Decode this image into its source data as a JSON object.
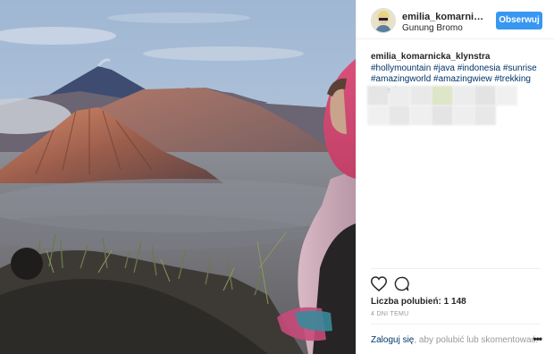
{
  "post": {
    "username": "emilia_komarnicka_klynstra",
    "location": "Gunung Bromo",
    "follow_label": "Obserwuj"
  },
  "caption": {
    "username": "emilia_komarnicka_klynstra",
    "hashtags": [
      "#hollymountain",
      "#java",
      "#indonesia",
      "#sunrise",
      "#amazingworld",
      "#amazingwiew",
      "#trekking",
      "#mystic"
    ]
  },
  "actions": {
    "like_icon": "heart-icon",
    "comment_icon": "comment-icon"
  },
  "likes_text": "Liczba polubień: 1 148",
  "time_text": "4 DNI TEMU",
  "footer": {
    "login_link": "Zaloguj się",
    "login_rest": ", aby polubić lub skomentować.",
    "more_label": "•••"
  },
  "colors": {
    "accent": "#3897f0",
    "link": "#003569",
    "text": "#262626",
    "muted": "#999999"
  }
}
